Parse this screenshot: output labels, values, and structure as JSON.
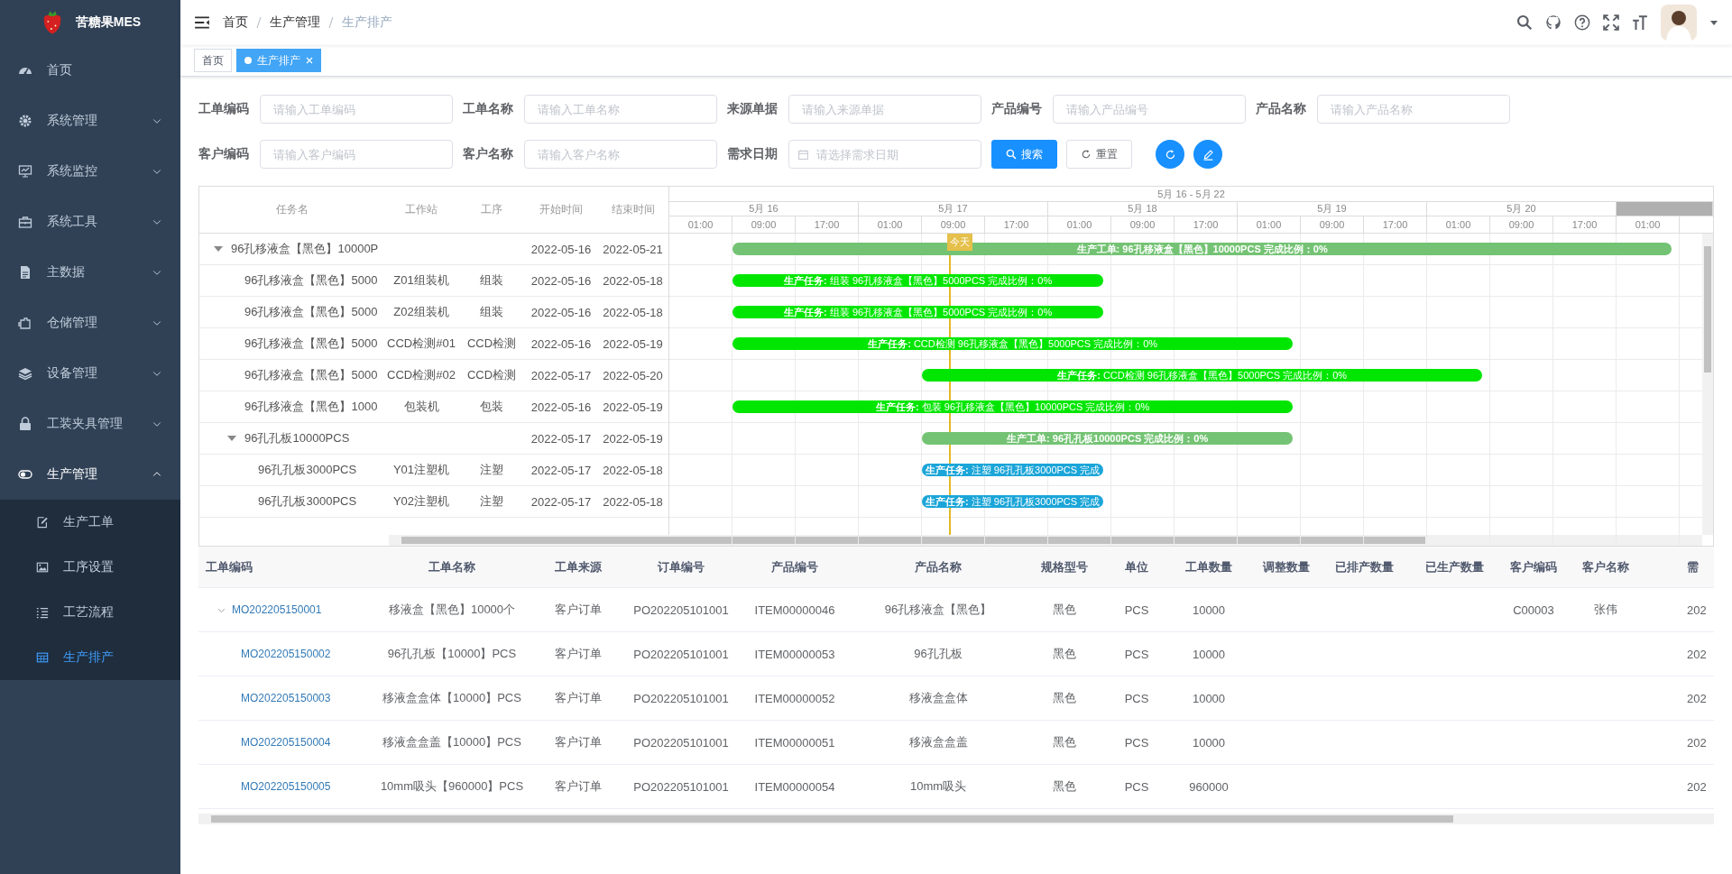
{
  "app": {
    "title": "苦糖果MES"
  },
  "sidebar": {
    "items": [
      {
        "label": "首页",
        "selected": false
      },
      {
        "label": "系统管理",
        "selected": false,
        "expanded": false
      },
      {
        "label": "系统监控",
        "selected": false,
        "expanded": false
      },
      {
        "label": "系统工具",
        "selected": false,
        "expanded": false
      },
      {
        "label": "主数据",
        "selected": false,
        "expanded": false
      },
      {
        "label": "仓储管理",
        "selected": false,
        "expanded": false
      },
      {
        "label": "设备管理",
        "selected": false,
        "expanded": false
      },
      {
        "label": "工装夹具管理",
        "selected": false,
        "expanded": false
      },
      {
        "label": "生产管理",
        "selected": false,
        "expanded": true,
        "children": [
          {
            "label": "生产工单",
            "selected": false
          },
          {
            "label": "工序设置",
            "selected": false
          },
          {
            "label": "工艺流程",
            "selected": false
          },
          {
            "label": "生产排产",
            "selected": true
          }
        ]
      }
    ]
  },
  "navbar": {
    "breadcrumb": [
      "首页",
      "生产管理",
      "生产排产"
    ]
  },
  "tags": [
    {
      "label": "首页",
      "selected": false
    },
    {
      "label": "生产排产",
      "selected": true
    }
  ],
  "filters": {
    "rows": [
      [
        {
          "label": "工单编码",
          "placeholder": "请输入工单编码",
          "kind": "text"
        },
        {
          "label": "工单名称",
          "placeholder": "请输入工单名称",
          "kind": "text"
        },
        {
          "label": "来源单据",
          "placeholder": "请输入来源单据",
          "kind": "text"
        },
        {
          "label": "产品编号",
          "placeholder": "请输入产品编号",
          "kind": "text"
        },
        {
          "label": "产品名称",
          "placeholder": "请输入产品名称",
          "kind": "text"
        }
      ],
      [
        {
          "label": "客户编码",
          "placeholder": "请输入客户编码",
          "kind": "text"
        },
        {
          "label": "客户名称",
          "placeholder": "请输入客户名称",
          "kind": "text"
        },
        {
          "label": "需求日期",
          "placeholder": "请选择需求日期",
          "kind": "date"
        }
      ]
    ],
    "buttons": [
      {
        "label": "搜索",
        "kind": "primary"
      },
      {
        "label": "重置",
        "kind": "default"
      }
    ]
  },
  "gantt": {
    "columns": [
      "任务名",
      "工作站",
      "工序",
      "开始时间",
      "结束时间"
    ],
    "range": "5月 16 - 5月 22",
    "days": [
      "5月 16",
      "5月 17",
      "5月 18",
      "5月 19",
      "5月 20"
    ],
    "hours": [
      "01:00",
      "09:00",
      "17:00",
      "01:00",
      "09:00",
      "17:00",
      "01:00",
      "09:00",
      "17:00",
      "01:00",
      "09:00",
      "17:00",
      "01:00",
      "09:00",
      "17:00",
      "01:00"
    ],
    "today": {
      "label": "今天",
      "position": {
        "level": 0.275
      }
    },
    "rows": [
      {
        "name": "96孔移液盒【黑色】10000P",
        "start": "2022-05-16",
        "end": "2022-05-21",
        "expanded": true,
        "bar": {
          "kind": "work_order",
          "text": "生产工单: 96孔移液盒【黑色】10000PCS 完成比例：0%",
          "color": "#74c374"
        },
        "children": [
          {
            "name": "96孔移液盒【黑色】5000",
            "station": "Z01组装机",
            "process": "组装",
            "start": "2022-05-16",
            "end": "2022-05-18",
            "bar": {
              "kind": "task",
              "text": "**生产任务:** 组装 96孔移液盒【黑色】5000PCS 完成比例：0%",
              "color": "#00e600"
            }
          },
          {
            "name": "96孔移液盒【黑色】5000",
            "station": "Z02组装机",
            "process": "组装",
            "start": "2022-05-16",
            "end": "2022-05-18",
            "bar": {
              "kind": "task",
              "text": "**生产任务:** 组装 96孔移液盒【黑色】5000PCS 完成比例：0%",
              "color": "#00e600"
            }
          },
          {
            "name": "96孔移液盒【黑色】5000",
            "station": "CCD检测#01",
            "process": "CCD检测",
            "start": "2022-05-16",
            "end": "2022-05-19",
            "bar": {
              "kind": "task",
              "text": "**生产任务:** CCD检测 96孔移液盒【黑色】5000PCS 完成比例：0%",
              "color": "#00e600"
            }
          },
          {
            "name": "96孔移液盒【黑色】5000",
            "station": "CCD检测#02",
            "process": "CCD检测",
            "start": "2022-05-17",
            "end": "2022-05-20",
            "bar": {
              "kind": "task",
              "text": "**生产任务:** CCD检测 96孔移液盒【黑色】5000PCS 完成比例：0%",
              "color": "#00e600"
            }
          },
          {
            "name": "96孔移液盒【黑色】1000",
            "station": "包装机",
            "process": "包装",
            "start": "2022-05-16",
            "end": "2022-05-19",
            "bar": {
              "kind": "task",
              "text": "**生产任务:** 包装 96孔移液盒【黑色】10000PCS 完成比例：0%",
              "color": "#00e600"
            }
          },
          {
            "name": "96孔孔板10000PCS",
            "start": "2022-05-17",
            "end": "2022-05-19",
            "expanded": true,
            "bar": {
              "kind": "work_order",
              "text": "生产工单: 96孔孔板10000PCS 完成比例：0%",
              "color": "#74c374"
            },
            "children": [
              {
                "name": "96孔孔板3000PCS",
                "station": "Y01注塑机",
                "process": "注塑",
                "start": "2022-05-17",
                "end": "2022-05-18",
                "bar": {
                  "kind": "task",
                  "text": "**生产任务:** 注塑 96孔孔板3000PCS 完成",
                  "color": "#1ba5d8"
                }
              },
              {
                "name": "96孔孔板3000PCS",
                "station": "Y02注塑机",
                "process": "注塑",
                "start": "2022-05-17",
                "end": "2022-05-18",
                "bar": {
                  "kind": "task",
                  "text": "**生产任务:** 注塑 96孔孔板3000PCS 完成",
                  "color": "#1ba5d8"
                }
              }
            ]
          }
        ]
      }
    ]
  },
  "table": {
    "columns": [
      "工单编码",
      "工单名称",
      "工单来源",
      "订单编号",
      "产品编号",
      "产品名称",
      "规格型号",
      "单位",
      "工单数量",
      "调整数量",
      "已排产数量",
      "已生产数量",
      "客户编码",
      "客户名称",
      "需"
    ],
    "rows": [
      {
        "expanded": true,
        "cells": [
          "MO202205150001",
          "移液盒【黑色】10000个",
          "客户订单",
          "PO202205101001",
          "ITEM00000046",
          "96孔移液盒【黑色】",
          "黑色",
          "PCS",
          "10000",
          null,
          null,
          null,
          "C00003",
          "张伟",
          "202"
        ],
        "children": [
          {
            "cells": [
              "MO202205150002",
              "96孔孔板【10000】PCS",
              "客户订单",
              "PO202205101001",
              "ITEM00000053",
              "96孔孔板",
              "黑色",
              "PCS",
              "10000",
              null,
              null,
              null,
              null,
              null,
              "202"
            ]
          },
          {
            "cells": [
              "MO202205150003",
              "移液盒盒体【10000】PCS",
              "客户订单",
              "PO202205101001",
              "ITEM00000052",
              "移液盒盒体",
              "黑色",
              "PCS",
              "10000",
              null,
              null,
              null,
              null,
              null,
              "202"
            ]
          },
          {
            "cells": [
              "MO202205150004",
              "移液盒盒盖【10000】PCS",
              "客户订单",
              "PO202205101001",
              "ITEM00000051",
              "移液盒盒盖",
              "黑色",
              "PCS",
              "10000",
              null,
              null,
              null,
              null,
              null,
              "202"
            ]
          },
          {
            "cells": [
              "MO202205150005",
              "10mm吸头【960000】PCS",
              "客户订单",
              "PO202205101001",
              "ITEM00000054",
              "10mm吸头",
              "黑色",
              "PCS",
              "960000",
              null,
              null,
              null,
              null,
              null,
              "202"
            ]
          }
        ]
      }
    ]
  }
}
